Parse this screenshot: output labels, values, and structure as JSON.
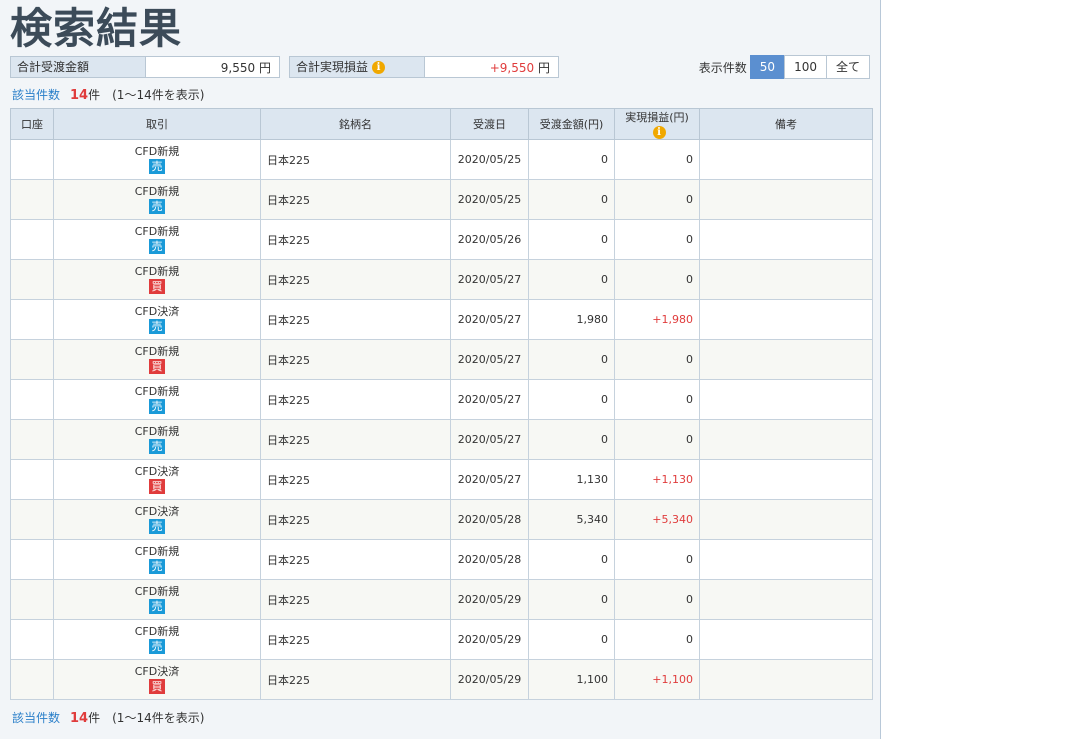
{
  "page": {
    "title": "検索結果"
  },
  "summary": {
    "total_transfer_label": "合計受渡金額",
    "total_transfer_value": "9,550",
    "total_pl_label": "合計実現損益",
    "total_pl_value": "+9,550",
    "currency": "円"
  },
  "display_count": {
    "label": "表示件数",
    "options": [
      "50",
      "100",
      "全て"
    ],
    "selected": "50"
  },
  "result_count": {
    "label": "該当件数",
    "count": "14",
    "unit": "件",
    "range_text": "(1～14件を表示)"
  },
  "table": {
    "headers": [
      "口座",
      "取引",
      "銘柄名",
      "受渡日",
      "受渡金額(円)",
      "実現損益(円)",
      "備考"
    ],
    "rows": [
      {
        "account": "",
        "trade": "CFD新規",
        "side": "売",
        "side_type": "sell",
        "name": "日本225",
        "date": "2020/05/25",
        "amount": "0",
        "pl": "0",
        "note": ""
      },
      {
        "account": "",
        "trade": "CFD新規",
        "side": "売",
        "side_type": "sell",
        "name": "日本225",
        "date": "2020/05/25",
        "amount": "0",
        "pl": "0",
        "note": ""
      },
      {
        "account": "",
        "trade": "CFD新規",
        "side": "売",
        "side_type": "sell",
        "name": "日本225",
        "date": "2020/05/26",
        "amount": "0",
        "pl": "0",
        "note": ""
      },
      {
        "account": "",
        "trade": "CFD新規",
        "side": "買",
        "side_type": "buy",
        "name": "日本225",
        "date": "2020/05/27",
        "amount": "0",
        "pl": "0",
        "note": ""
      },
      {
        "account": "",
        "trade": "CFD決済",
        "side": "売",
        "side_type": "sell",
        "name": "日本225",
        "date": "2020/05/27",
        "amount": "1,980",
        "pl": "+1,980",
        "note": ""
      },
      {
        "account": "",
        "trade": "CFD新規",
        "side": "買",
        "side_type": "buy",
        "name": "日本225",
        "date": "2020/05/27",
        "amount": "0",
        "pl": "0",
        "note": ""
      },
      {
        "account": "",
        "trade": "CFD新規",
        "side": "売",
        "side_type": "sell",
        "name": "日本225",
        "date": "2020/05/27",
        "amount": "0",
        "pl": "0",
        "note": ""
      },
      {
        "account": "",
        "trade": "CFD新規",
        "side": "売",
        "side_type": "sell",
        "name": "日本225",
        "date": "2020/05/27",
        "amount": "0",
        "pl": "0",
        "note": ""
      },
      {
        "account": "",
        "trade": "CFD決済",
        "side": "買",
        "side_type": "buy",
        "name": "日本225",
        "date": "2020/05/27",
        "amount": "1,130",
        "pl": "+1,130",
        "note": ""
      },
      {
        "account": "",
        "trade": "CFD決済",
        "side": "売",
        "side_type": "sell",
        "name": "日本225",
        "date": "2020/05/28",
        "amount": "5,340",
        "pl": "+5,340",
        "note": ""
      },
      {
        "account": "",
        "trade": "CFD新規",
        "side": "売",
        "side_type": "sell",
        "name": "日本225",
        "date": "2020/05/28",
        "amount": "0",
        "pl": "0",
        "note": ""
      },
      {
        "account": "",
        "trade": "CFD新規",
        "side": "売",
        "side_type": "sell",
        "name": "日本225",
        "date": "2020/05/29",
        "amount": "0",
        "pl": "0",
        "note": ""
      },
      {
        "account": "",
        "trade": "CFD新規",
        "side": "売",
        "side_type": "sell",
        "name": "日本225",
        "date": "2020/05/29",
        "amount": "0",
        "pl": "0",
        "note": ""
      },
      {
        "account": "",
        "trade": "CFD決済",
        "side": "買",
        "side_type": "buy",
        "name": "日本225",
        "date": "2020/05/29",
        "amount": "1,100",
        "pl": "+1,100",
        "note": ""
      }
    ]
  }
}
